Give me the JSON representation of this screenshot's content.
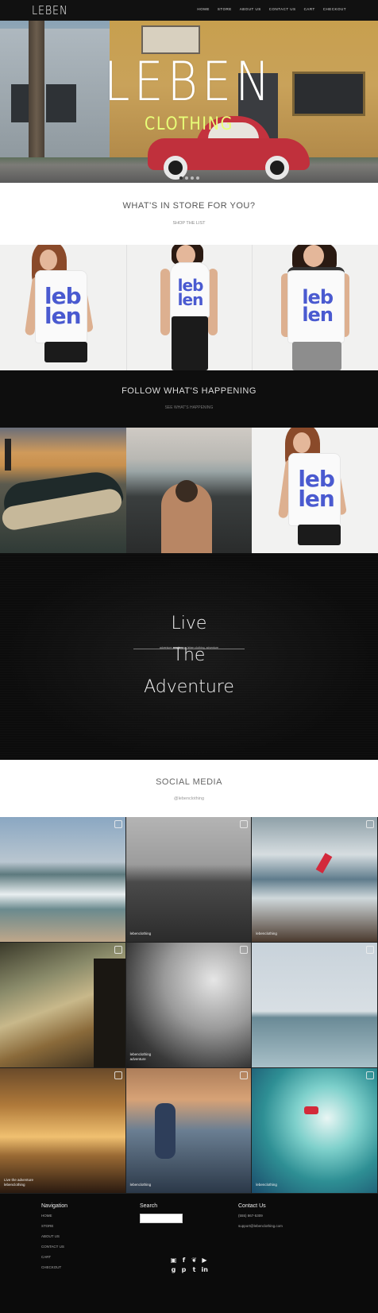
{
  "brand": "LEBEN",
  "nav": [
    "HOME",
    "STORE",
    "ABOUT US",
    "CONTACT US",
    "CART",
    "CHECKOUT"
  ],
  "hero": {
    "title": "LEBEN",
    "subtitle": "CLOTHING"
  },
  "store": {
    "heading": "WHAT'S IN STORE FOR YOU?",
    "sub": "SHOP THE LIST"
  },
  "products": [
    {
      "logo": "leb\nlen"
    },
    {
      "logo": "leb\nlen"
    },
    {
      "logo": "leb\nlen"
    }
  ],
  "follow": {
    "heading": "FOLLOW WHAT'S HAPPENING",
    "sub": "SEE WHAT'S HAPPENING"
  },
  "adventure": {
    "line1": "Live",
    "line2": "The",
    "line3": "Adventure",
    "tagline": "adventure awaits you, leben clothing, adventure"
  },
  "social": {
    "heading": "SOCIAL MEDIA",
    "handle": "@lebenclothing"
  },
  "social_tiles": [
    {
      "caption": ""
    },
    {
      "caption": "lebenclothing"
    },
    {
      "caption": "lebenclothing"
    },
    {
      "caption": ""
    },
    {
      "caption": "lebenclothing\nadventure"
    },
    {
      "caption": ""
    },
    {
      "caption": "Live the adventure\nlebenclothing"
    },
    {
      "caption": "lebenclothing"
    },
    {
      "caption": "lebenclothing"
    }
  ],
  "footer": {
    "nav_heading": "Navigation",
    "nav_links": [
      "HOME",
      "STORE",
      "ABOUT US",
      "CONTACT US",
      "CART",
      "CHECKOUT"
    ],
    "search_heading": "Search",
    "contact_heading": "Contact Us",
    "contact_phone": "(555) 867-5309",
    "contact_email": "support@lebenclothing.com"
  },
  "social_icons": [
    "instagram-icon",
    "facebook-icon",
    "twitter-icon",
    "youtube-icon",
    "googleplus-icon",
    "pinterest-icon",
    "tumblr-icon",
    "linkedin-icon"
  ],
  "colors": {
    "accent": "#e8ff78",
    "logo_blue": "#4a5ad0",
    "car_red": "#c0303c"
  }
}
